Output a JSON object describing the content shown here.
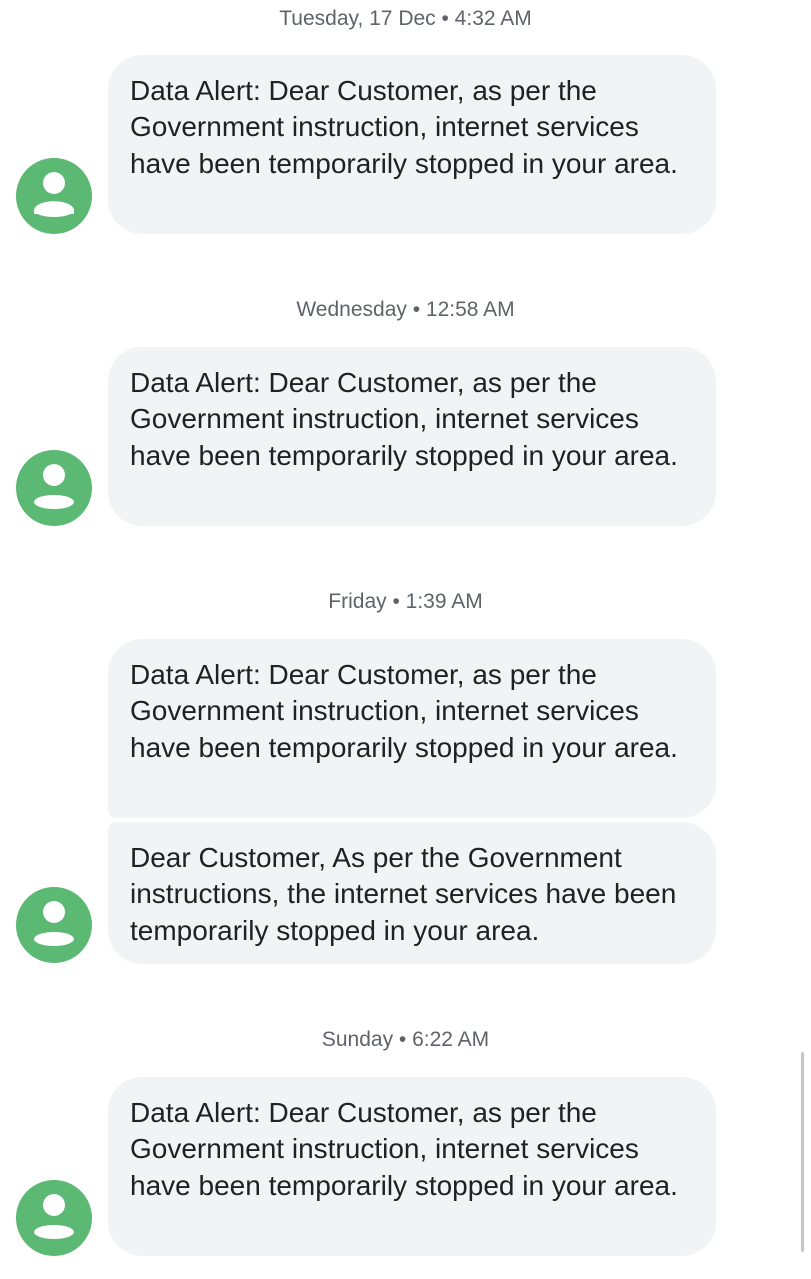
{
  "messages": {
    "groups": [
      {
        "timestamp": "Tuesday, 17 Dec • 4:32 AM",
        "bubbles": [
          "Data Alert: Dear Customer, as per the Government instruction, internet services have been temporarily stopped in your area."
        ]
      },
      {
        "timestamp": "Wednesday • 12:58 AM",
        "bubbles": [
          "Data Alert: Dear Customer, as per the Government instruction, internet services have been temporarily stopped in your area."
        ]
      },
      {
        "timestamp": "Friday • 1:39 AM",
        "bubbles": [
          "Data Alert: Dear Customer, as per the Government instruction, internet services have been temporarily stopped in your area.",
          "Dear Customer, As per the Government instructions, the internet services have been temporarily stopped in your area."
        ]
      },
      {
        "timestamp": "Sunday • 6:22 AM",
        "bubbles": [
          "Data Alert: Dear Customer, as per the Government instruction, internet services have been temporarily stopped in your area."
        ]
      }
    ]
  },
  "avatar": {
    "icon": "person-icon",
    "color": "#5bb974"
  },
  "bubble_color": "#f1f3f4"
}
